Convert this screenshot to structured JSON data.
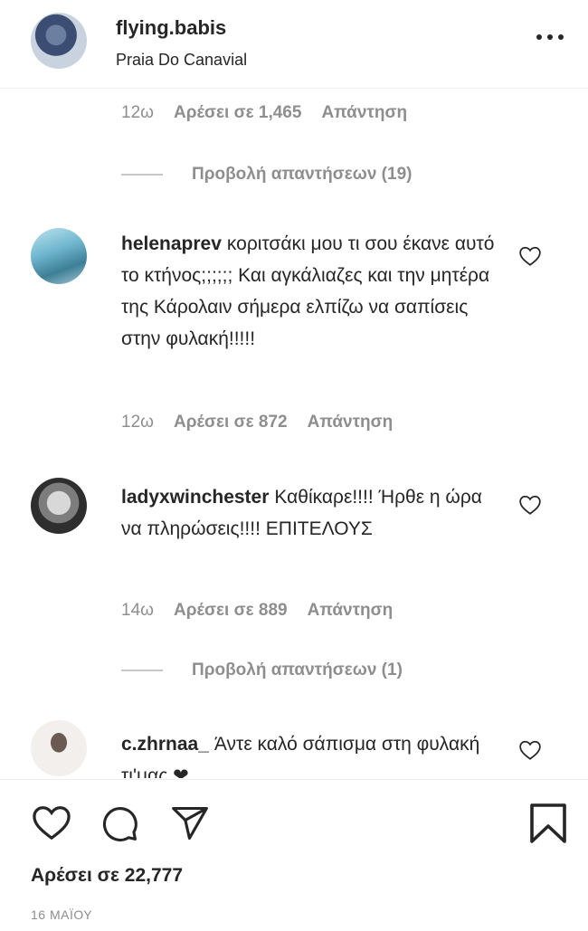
{
  "post": {
    "username": "flying.babis",
    "location": "Praia Do Canavial",
    "likes_text": "Αρέσει σε 22,777",
    "date": "16 ΜΑΪΟΥ"
  },
  "first_meta": {
    "time": "12ω",
    "likes": "Αρέσει σε 1,465",
    "reply": "Απάντηση"
  },
  "view_replies_1": "Προβολή απαντήσεων (19)",
  "comments": [
    {
      "username": "helenaprev",
      "text": "κοριτσάκι μου τι σου έκανε αυτό το κτήνος;;;;;; Και αγκάλιαζες και την μητέρα της Κάρολαιν σήμερα ελπίζω να σαπίσεις στην φυλακή!!!!!",
      "time": "12ω",
      "likes": "Αρέσει σε 872",
      "reply": "Απάντηση"
    },
    {
      "username": "ladyxwinchester",
      "text": "Καθίκαρε!!!! Ήρθε η ώρα να πληρώσεις!!!! ΕΠΙΤΕΛΟΥΣ",
      "time": "14ω",
      "likes": "Αρέσει σε 889",
      "reply": "Απάντηση"
    },
    {
      "username": "c.zhrnaa_",
      "text": "Άντε καλό σάπισμα στη φυλακή τι'μας ❤"
    }
  ],
  "view_replies_2": "Προβολή απαντήσεων (1)",
  "icons": [
    "more-options-icon",
    "heart-icon",
    "comment-icon",
    "share-icon",
    "bookmark-icon"
  ],
  "colors": {
    "text": "#262626",
    "secondary": "#8e8e8e",
    "heart_emoji": "#e0245e"
  }
}
